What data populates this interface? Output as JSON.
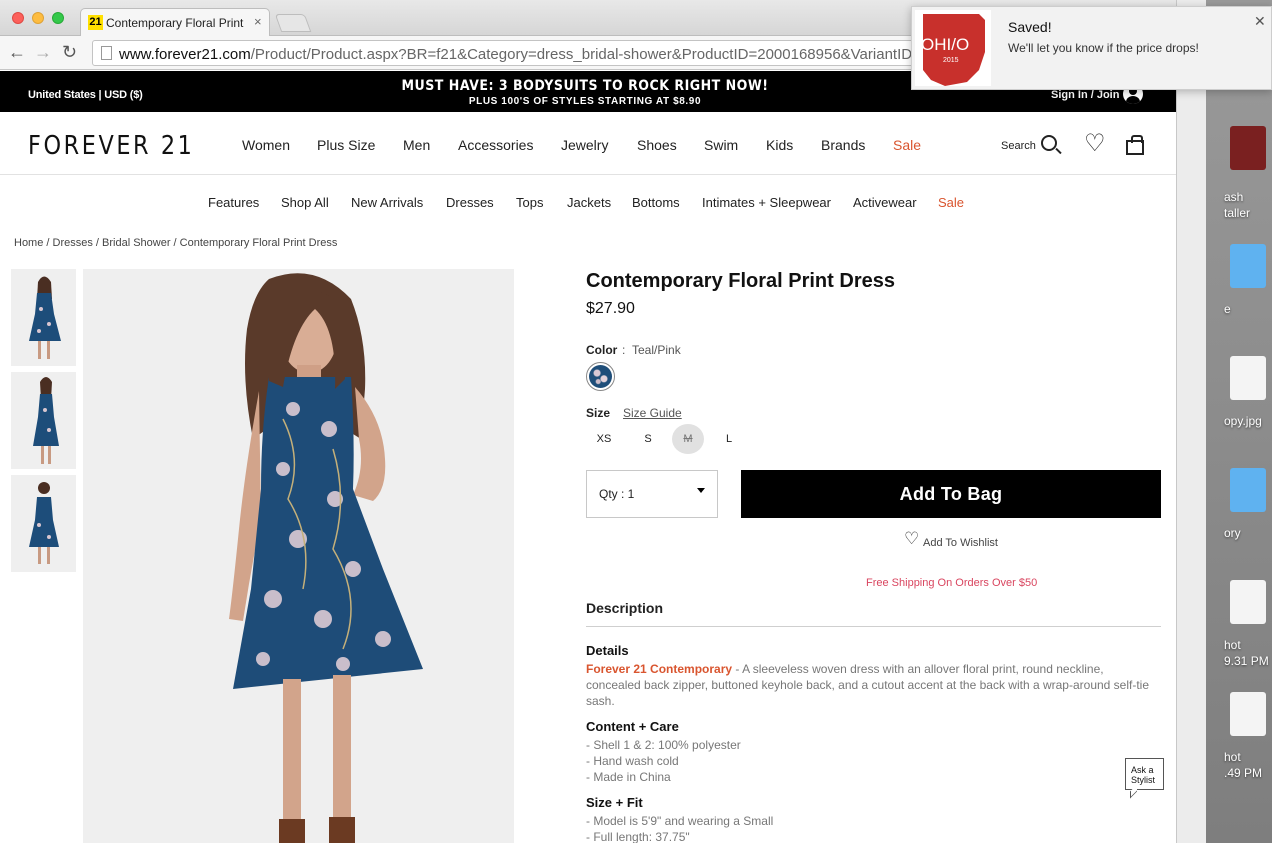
{
  "browser": {
    "tab_title": "Contemporary Floral Print D",
    "favicon": "21",
    "url_domain": "www.forever21.com",
    "url_path": "/Product/Product.aspx?BR=f21&Category=dress_bridal-shower&ProductID=2000168956&VariantID="
  },
  "notification": {
    "title": "Saved!",
    "body": "We'll let you know if the price drops!",
    "logo_text": "OHI/O",
    "logo_year": "2015"
  },
  "promo": {
    "country": "United States | USD ($)",
    "headline": "MUST HAVE: 3 BODYSUITS TO ROCK RIGHT NOW!",
    "subline": "PLUS 100'S OF STYLES STARTING AT $8.90",
    "signin": "Sign In / Join"
  },
  "header": {
    "logo": "FOREVER 21",
    "nav": [
      "Women",
      "Plus Size",
      "Men",
      "Accessories",
      "Jewelry",
      "Shoes",
      "Swim",
      "Kids",
      "Brands",
      "Sale"
    ],
    "search_label": "Search"
  },
  "subnav": [
    "Features",
    "Shop All",
    "New Arrivals",
    "Dresses",
    "Tops",
    "Jackets",
    "Bottoms",
    "Intimates + Sleepwear",
    "Activewear",
    "Sale"
  ],
  "breadcrumb": "Home / Dresses / Bridal Shower / Contemporary Floral Print Dress",
  "product": {
    "title": "Contemporary Floral Print Dress",
    "price": "$27.90",
    "color_label": "Color",
    "color_sep": ":",
    "color_value": "Teal/Pink",
    "size_label": "Size",
    "size_guide": "Size Guide",
    "sizes": [
      "XS",
      "S",
      "M",
      "L"
    ],
    "qty_label": "Qty : 1",
    "add_to_bag": "Add To Bag",
    "wishlist": "Add To Wishlist",
    "free_shipping": "Free Shipping On Orders Over $50"
  },
  "description": {
    "title": "Description",
    "details_h": "Details",
    "brand": "Forever 21 Contemporary",
    "details_text": " - A sleeveless woven dress with an allover floral print, round neckline, concealed back zipper, buttoned keyhole back, and a cutout accent at the back with a wrap-around self-tie sash.",
    "content_h": "Content + Care",
    "content": [
      "- Shell 1 & 2: 100% polyester",
      "- Hand wash cold",
      "- Made in China"
    ],
    "size_fit_h": "Size + Fit",
    "size_fit": [
      "- Model is 5'9\" and wearing a Small",
      "- Full length: 37.75\""
    ]
  },
  "stylist": {
    "line1": "Ask a",
    "line2": "Stylist"
  },
  "desktop": {
    "labels": [
      "ash",
      "taller",
      "e",
      "opy.jpg",
      "ory",
      "hot",
      "9.31 PM",
      "hot",
      ".49 PM"
    ]
  }
}
